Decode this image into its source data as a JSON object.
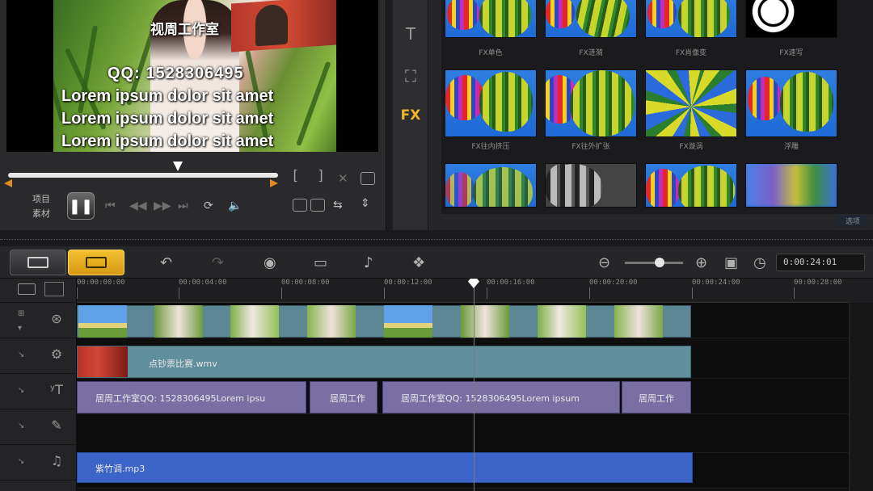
{
  "preview": {
    "overlay_lines": {
      "studio": "视周工作室",
      "qq": "QQ:  1528306495",
      "line1": "Lorem ipsum dolor sit amet",
      "line2": "Lorem ipsum dolor sit amet",
      "line3": "Lorem ipsum dolor sit amet"
    },
    "mode_labels": [
      "项目",
      "素材"
    ],
    "bracket_in": "[",
    "bracket_out": "]"
  },
  "library": {
    "sidebar_icons": [
      "title-icon",
      "transition-icon",
      "fx-icon"
    ],
    "fx_label": "FX",
    "thumbnails": [
      {
        "label": "FX单色"
      },
      {
        "label": "FX涟漪"
      },
      {
        "label": "FX肖像变"
      },
      {
        "label": "FX速写"
      },
      {
        "label": "FX往内挤压"
      },
      {
        "label": "FX往外扩张"
      },
      {
        "label": "FX漩涡"
      },
      {
        "label": "浮雕"
      },
      {
        "label": ""
      },
      {
        "label": ""
      },
      {
        "label": ""
      },
      {
        "label": ""
      }
    ],
    "footer": "选项"
  },
  "toolbar": {
    "timecode": "0:00:24:01"
  },
  "timeline": {
    "ruler_ticks": [
      "00:00:00:00",
      "00:00:04:00",
      "00:00:08:00",
      "00:00:12:00",
      "00:00:16:00",
      "00:00:20:00",
      "00:00:24:00",
      "00:00:28:00"
    ],
    "overlay_clip": "点钞票比赛.wmv",
    "title_clips": [
      "居周工作室QQ: 1528306495Lorem ipsu",
      "居周工作",
      "居周工作室QQ: 1528306495Lorem ipsum",
      "居周工作"
    ],
    "audio_clip": "紫竹调.mp3"
  }
}
